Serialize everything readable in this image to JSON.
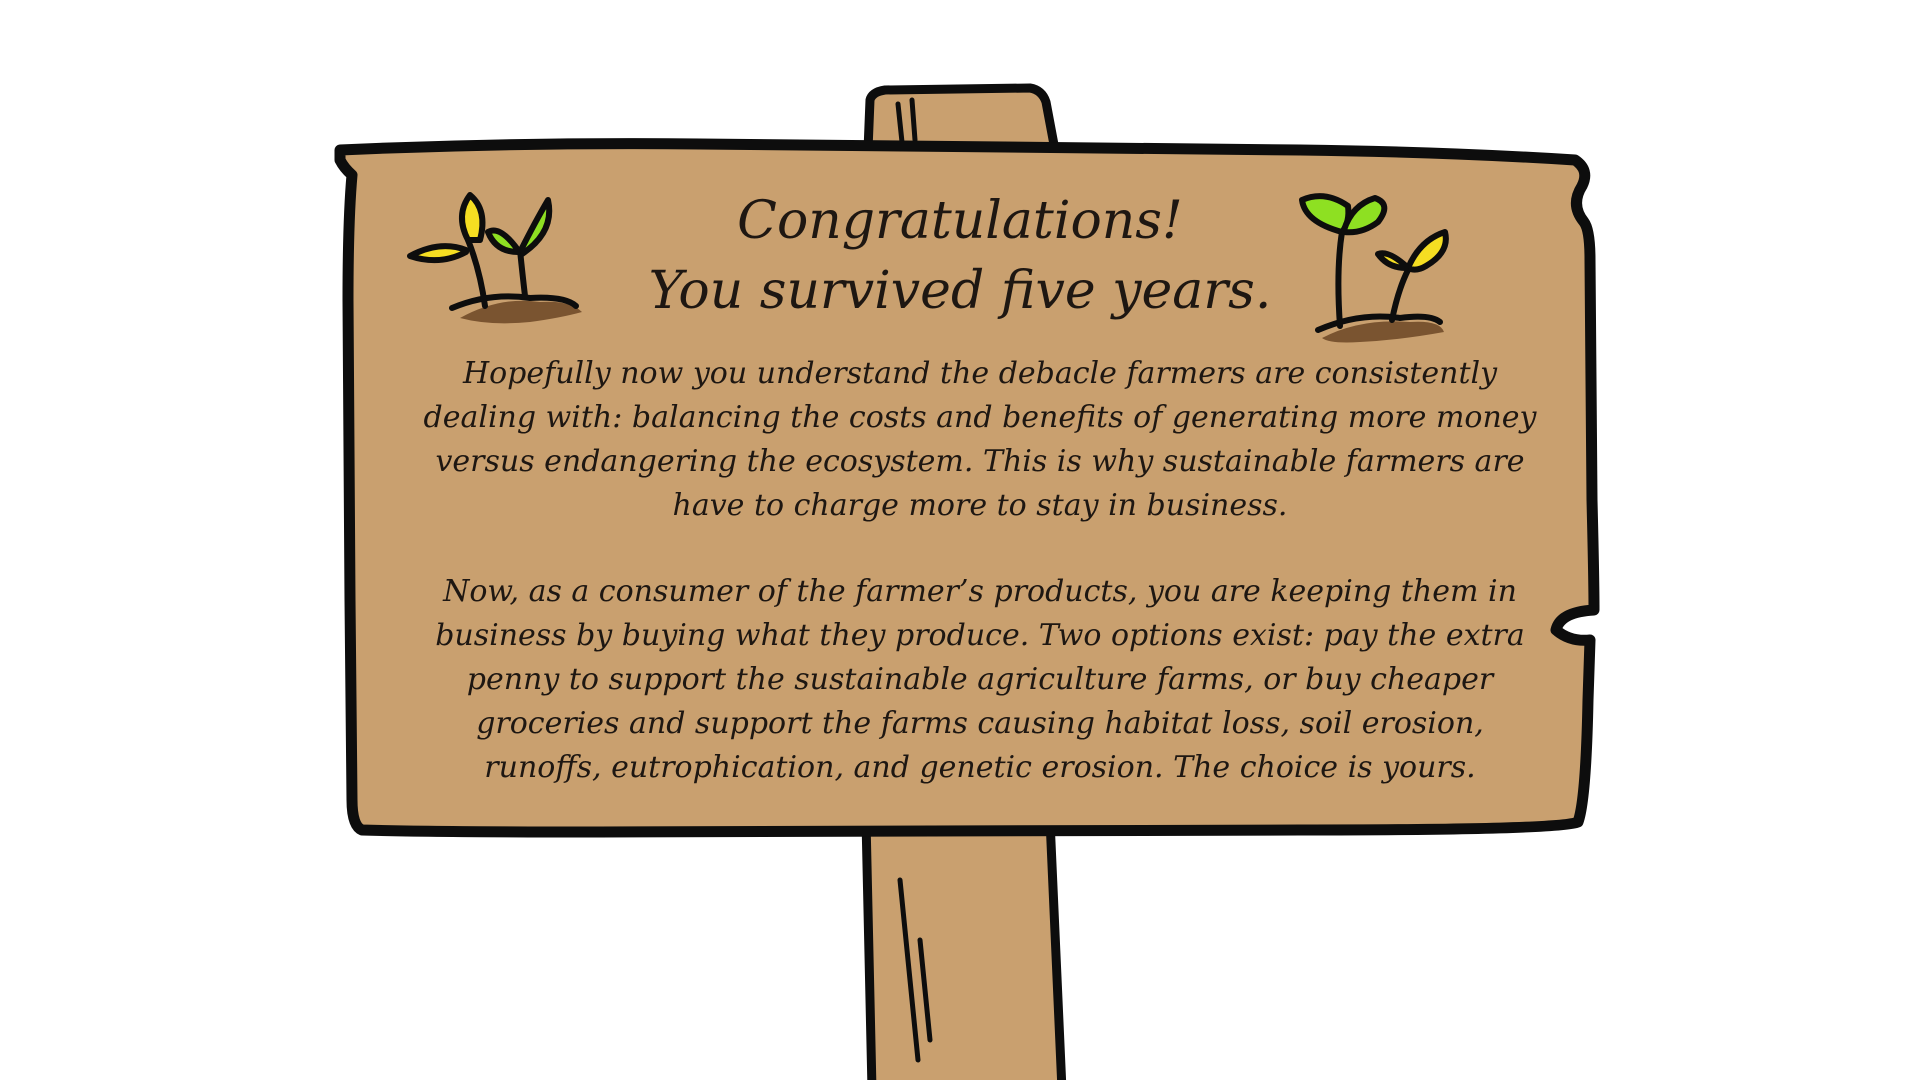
{
  "colors": {
    "wood": "#c9a06f",
    "outline": "#0d0d0d",
    "shadow": "#7a5430",
    "leaf_yellow": "#f5de22",
    "leaf_green": "#8ee022",
    "text": "#1e1712",
    "background": "#ffffff"
  },
  "icons": {
    "left_sprout": "sprout-icon",
    "right_sprout": "sprout-icon"
  },
  "sign": {
    "heading_line1": "Congratulations!",
    "heading_line2": "You survived five years.",
    "paragraph1": "Hopefully now you understand the debacle farmers are consistently dealing with: balancing the costs and benefits of generating more money versus endangering the ecosystem. This is why sustainable farmers are have to charge more to stay in business.",
    "paragraph2": "Now, as a consumer of the farmer’s products, you are keeping them in business by buying what they produce. Two options exist: pay the extra penny to support the sustainable agriculture farms, or buy cheaper groceries and support the farms causing habitat loss, soil erosion, runoffs, eutrophication, and genetic erosion.  The choice is yours."
  }
}
